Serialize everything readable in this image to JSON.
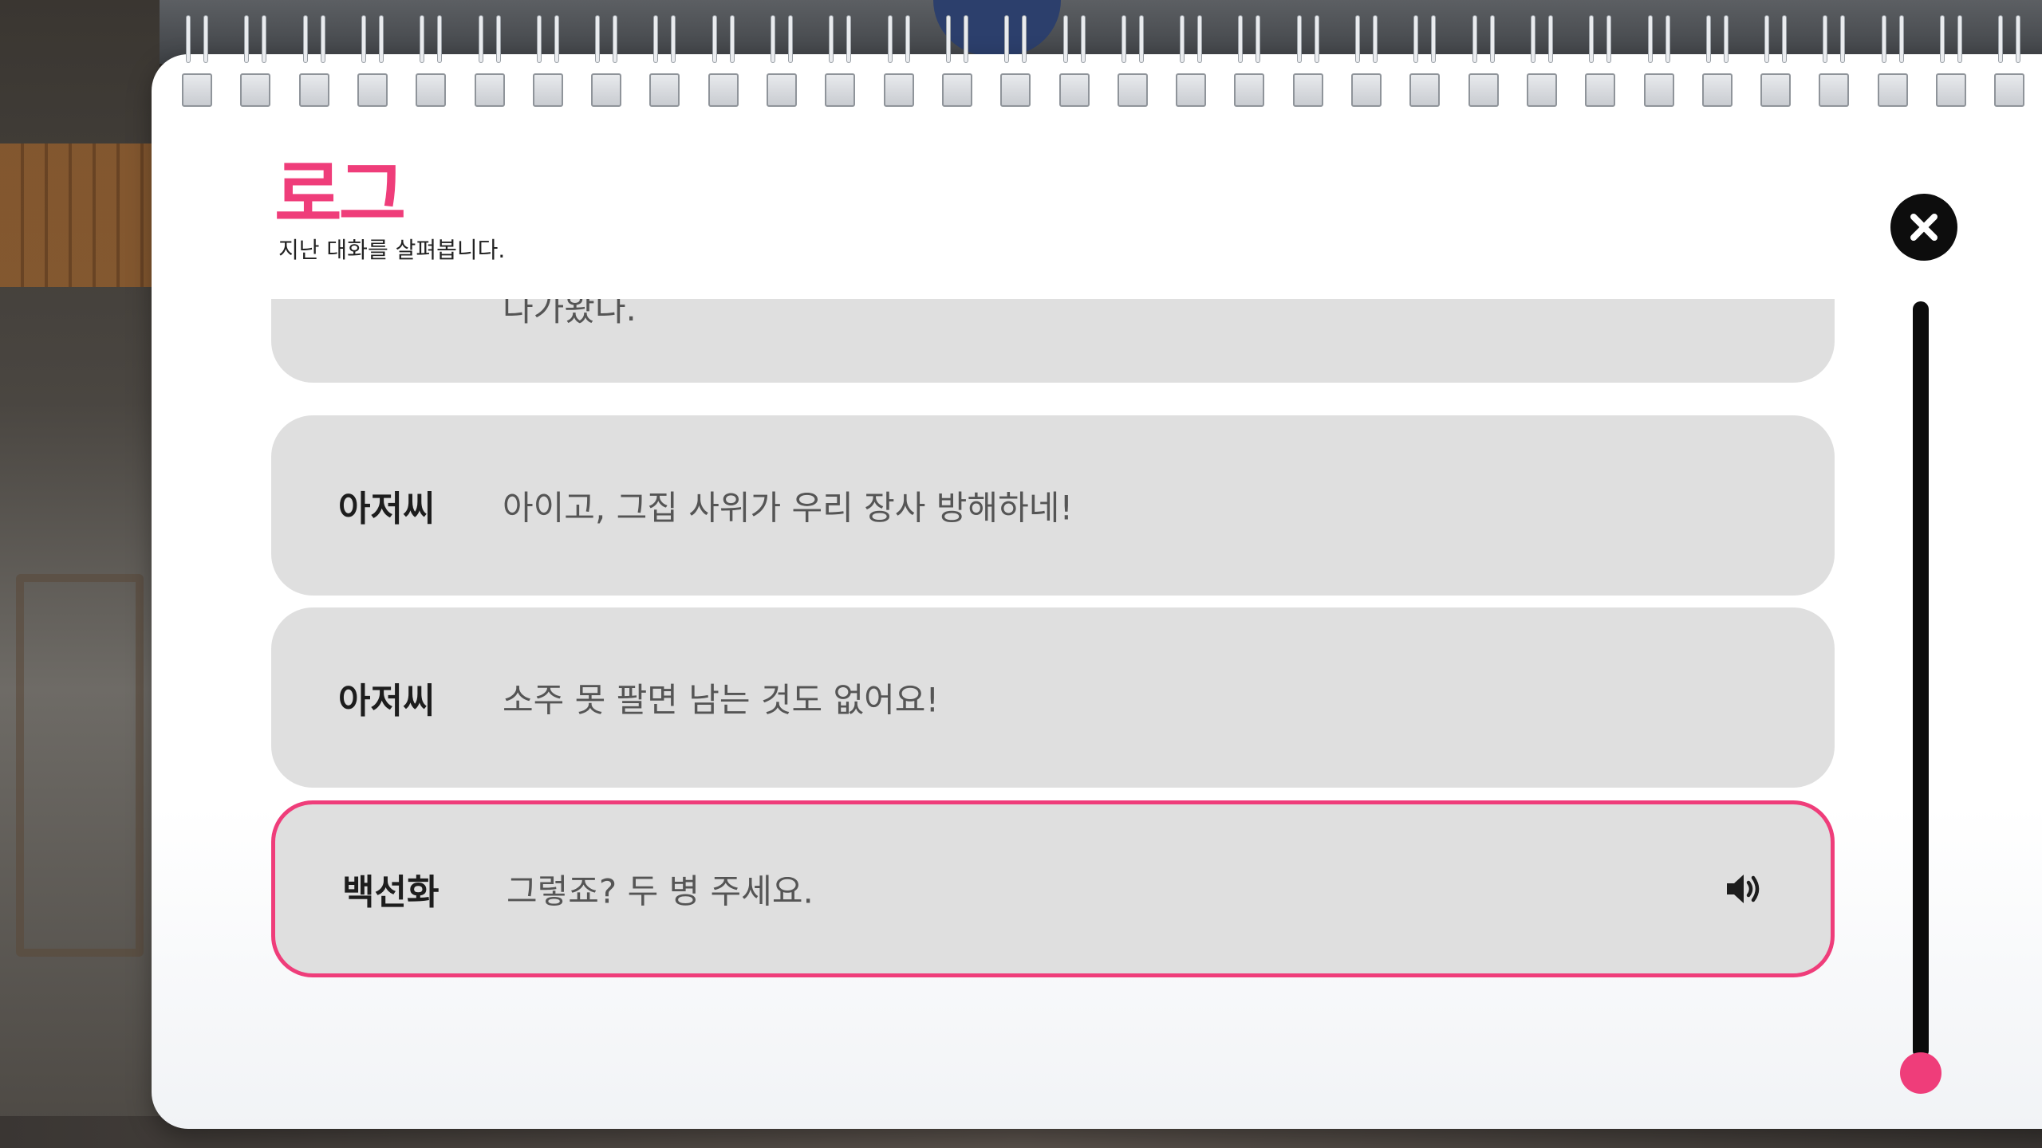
{
  "colors": {
    "accent": "#ef3d7a",
    "entry_bg": "#dfdfdf",
    "close_bg": "#0d0d0d"
  },
  "header": {
    "title": "로그",
    "subtitle": "지난 대화를 살펴봅니다."
  },
  "log": {
    "entries": [
      {
        "speaker": "",
        "text": "다가왔다."
      },
      {
        "speaker": "아저씨",
        "text": "아이고, 그집 사위가 우리 장사 방해하네!"
      },
      {
        "speaker": "아저씨",
        "text": "소주 못 팔면 남는 것도 없어요!"
      },
      {
        "speaker": "백선화",
        "text": "그렇죠? 두 병 주세요.",
        "has_voice": true,
        "current": true
      }
    ]
  },
  "icons": {
    "close": "close-icon",
    "voice": "speaker-icon"
  },
  "scroll": {
    "position": 1.0
  }
}
